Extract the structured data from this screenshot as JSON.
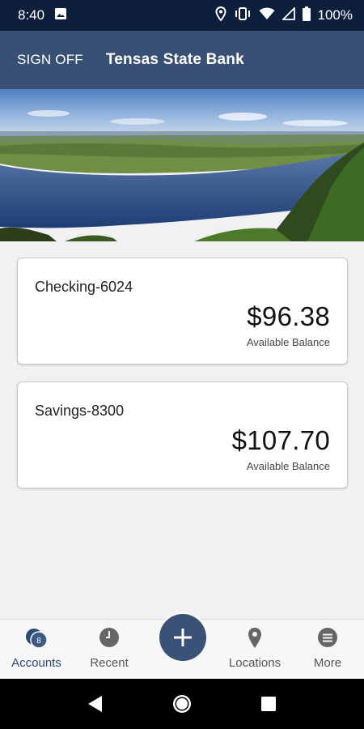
{
  "status_bar": {
    "time": "8:40",
    "battery_text": "100%",
    "icons": [
      "image-icon",
      "location-icon",
      "vibrate-icon",
      "wifi-icon",
      "cell-signal-icon",
      "battery-icon"
    ]
  },
  "header": {
    "sign_off_label": "SIGN OFF",
    "bank_name": "Tensas State Bank"
  },
  "accounts": [
    {
      "name": "Checking-6024",
      "balance": "$96.38",
      "caption": "Available Balance"
    },
    {
      "name": "Savings-8300",
      "balance": "$107.70",
      "caption": "Available Balance"
    }
  ],
  "bottom_nav": {
    "accounts_label": "Accounts",
    "accounts_badge": "8",
    "recent_label": "Recent",
    "locations_label": "Locations",
    "more_label": "More",
    "add_symbol": "+"
  },
  "colors": {
    "status_bar": "#0d1f3a",
    "header": "#385073",
    "accent": "#3a5275",
    "background": "#f1f1f3"
  }
}
